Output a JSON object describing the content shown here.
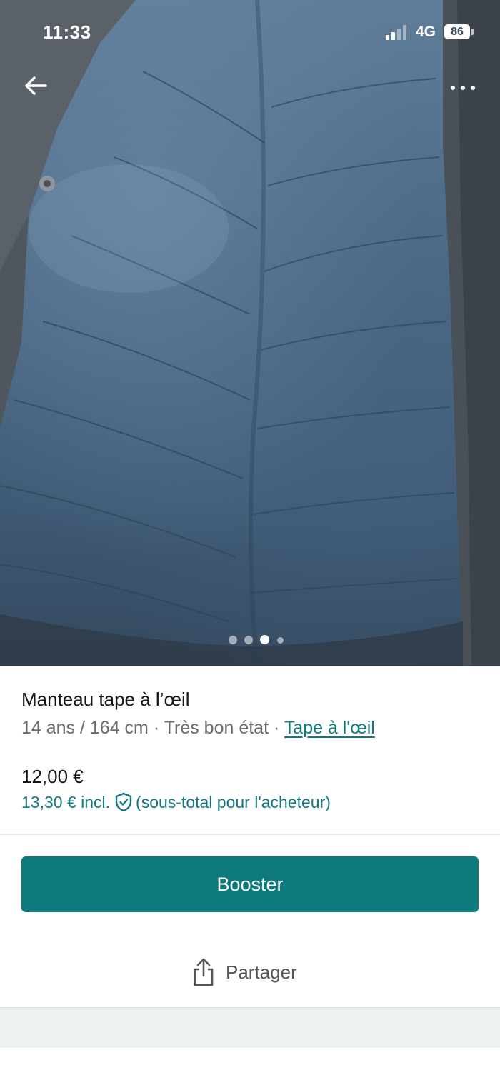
{
  "status_bar": {
    "time": "11:33",
    "network": "4G",
    "battery": "86"
  },
  "gallery": {
    "photo_count": 4,
    "active_index": 2
  },
  "item": {
    "title": "Manteau tape à l’œil",
    "meta_prefix": "14 ans / 164 cm · Très bon état · ",
    "brand": "Tape à l'œil",
    "price": "12,00 €",
    "buyer_price": "13,30 € incl.",
    "buyer_note": "(sous-total pour l'acheteur)"
  },
  "actions": {
    "booster_label": "Booster",
    "share_label": "Partager"
  },
  "colors": {
    "accent": "#0f7a7e",
    "link": "#117a7e",
    "meta_text": "#6b6b6b"
  },
  "icons": {
    "back": "back-arrow-icon",
    "more": "more-dots-icon",
    "protection": "shield-check-icon",
    "share": "share-icon"
  }
}
